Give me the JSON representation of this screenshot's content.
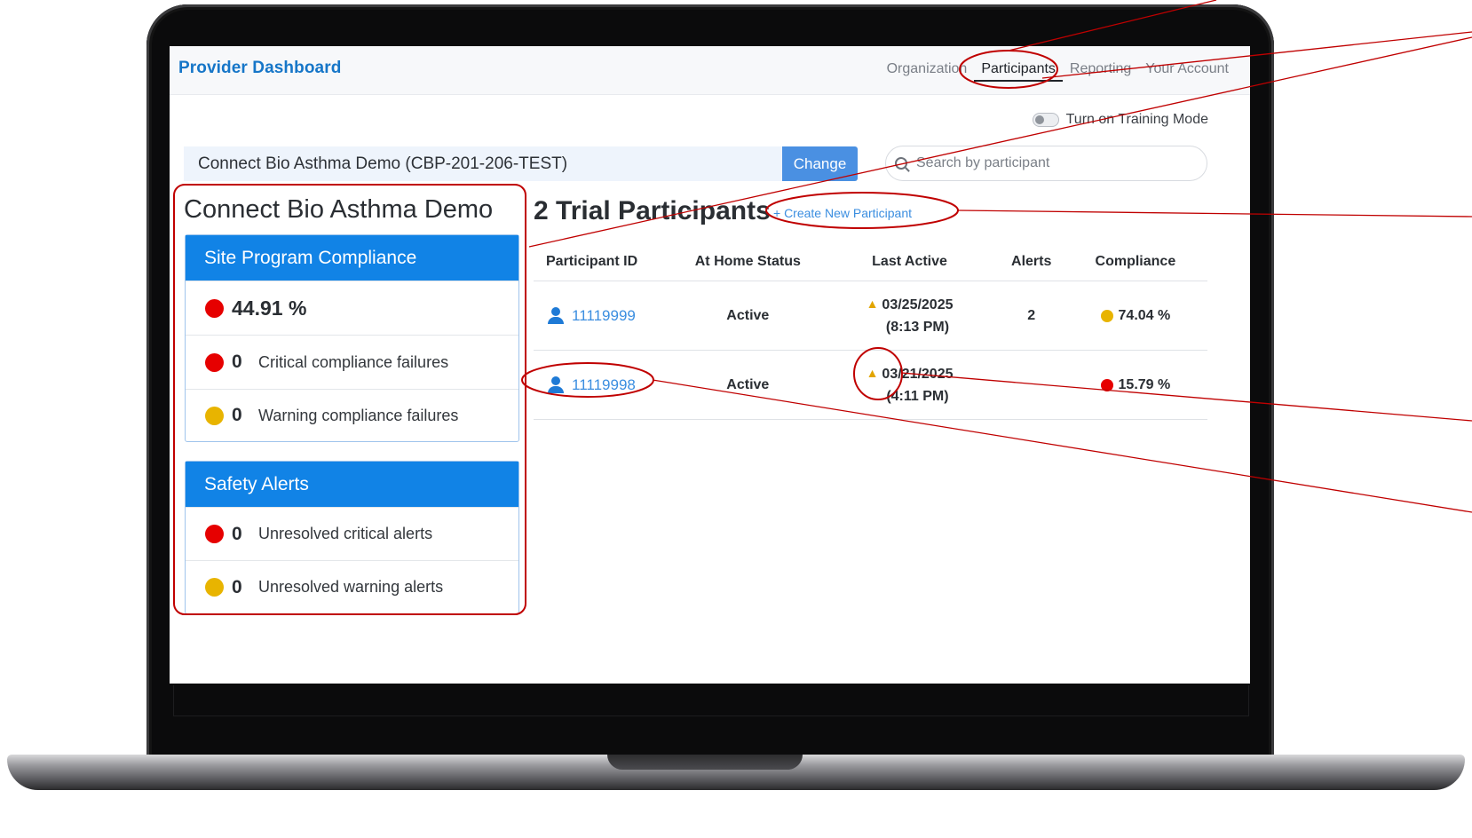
{
  "app": {
    "brand": "Provider Dashboard",
    "nav": [
      "Organization",
      "Participants",
      "Reporting",
      "Your Account"
    ],
    "active_nav": "Participants"
  },
  "training_mode": {
    "label": "Turn on Training Mode",
    "enabled": false
  },
  "project": {
    "name": "Connect Bio Asthma Demo (CBP-201-206-TEST)",
    "change_label": "Change"
  },
  "search": {
    "placeholder": "Search by participant"
  },
  "sidebar": {
    "title": "Connect Bio Asthma Demo",
    "compliance": {
      "heading": "Site Program Compliance",
      "overall_pct": "44.91 %",
      "critical": {
        "count": "0",
        "label": "Critical compliance failures"
      },
      "warning": {
        "count": "0",
        "label": "Warning compliance failures"
      }
    },
    "safety": {
      "heading": "Safety Alerts",
      "critical": {
        "count": "0",
        "label": "Unresolved critical alerts"
      },
      "warning": {
        "count": "0",
        "label": "Unresolved warning alerts"
      }
    }
  },
  "participants": {
    "title": "2 Trial Participants",
    "create_label": "+ Create New Participant",
    "columns": [
      "Participant ID",
      "At Home Status",
      "Last Active",
      "Alerts",
      "Compliance"
    ],
    "rows": [
      {
        "id": "11119999",
        "status": "Active",
        "last_active_date": "03/25/2025",
        "last_active_time": "(8:13 PM)",
        "alerts": "2",
        "compliance": "74.04 %",
        "compliance_color": "#e8b400"
      },
      {
        "id": "11119998",
        "status": "Active",
        "last_active_date": "03/21/2025",
        "last_active_time": "(4:11 PM)",
        "alerts": "",
        "compliance": "15.79 %",
        "compliance_color": "#e60000"
      }
    ]
  },
  "colors": {
    "red": "#e60000",
    "yellow": "#e8b400",
    "primary": "#1183e6",
    "annotation": "#c00000"
  }
}
